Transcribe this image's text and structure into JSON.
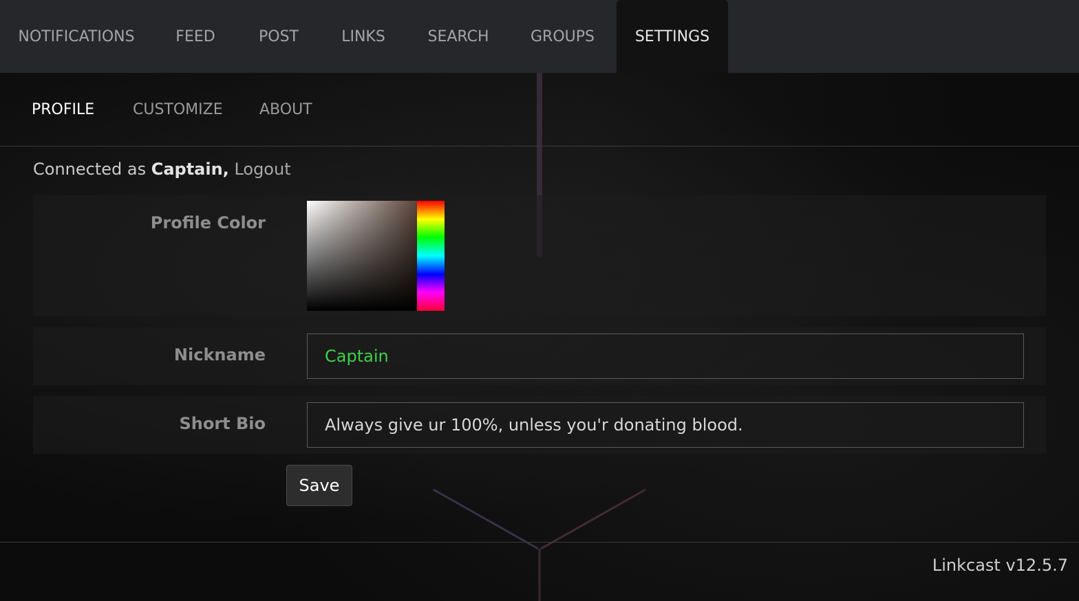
{
  "top_nav": {
    "items": [
      {
        "label": "NOTIFICATIONS"
      },
      {
        "label": "FEED"
      },
      {
        "label": "POST"
      },
      {
        "label": "LINKS"
      },
      {
        "label": "SEARCH"
      },
      {
        "label": "GROUPS"
      },
      {
        "label": "SETTINGS",
        "active": true
      }
    ]
  },
  "sub_nav": {
    "items": [
      {
        "label": "PROFILE",
        "active": true
      },
      {
        "label": "CUSTOMIZE"
      },
      {
        "label": "ABOUT"
      }
    ]
  },
  "session": {
    "prefix": "Connected as ",
    "username": "Captain,",
    "logout_label": "Logout"
  },
  "form": {
    "profile_color_label": "Profile Color",
    "nickname_label": "Nickname",
    "nickname_value": "Captain",
    "bio_label": "Short Bio",
    "bio_value": "Always give ur 100%, unless you'r donating blood.",
    "save_label": "Save"
  },
  "footer": {
    "version": "Linkcast v12.5.7"
  },
  "colors": {
    "top_nav_bg": "#25272b",
    "nickname_text": "#3fd14a"
  }
}
